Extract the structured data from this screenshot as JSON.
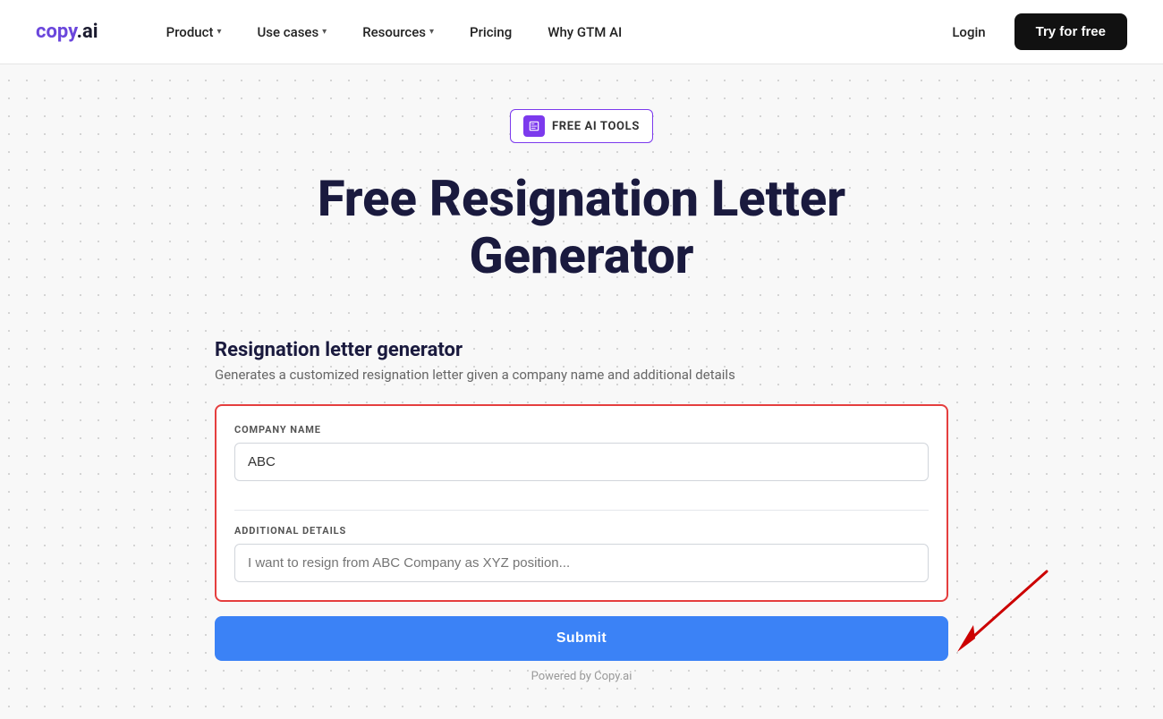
{
  "logo": {
    "text": "copy.ai"
  },
  "nav": {
    "items": [
      {
        "label": "Product",
        "hasDropdown": true
      },
      {
        "label": "Use cases",
        "hasDropdown": true
      },
      {
        "label": "Resources",
        "hasDropdown": true
      },
      {
        "label": "Pricing",
        "hasDropdown": false
      },
      {
        "label": "Why GTM AI",
        "hasDropdown": false
      }
    ],
    "login_label": "Login",
    "try_label": "Try for free"
  },
  "badge": {
    "text": "FREE AI TOOLS"
  },
  "hero": {
    "title": "Free Resignation Letter Generator"
  },
  "form": {
    "section_title": "Resignation letter generator",
    "section_desc": "Generates a customized resignation letter given a company name and additional details",
    "company_name_label": "COMPANY NAME",
    "company_name_value": "ABC",
    "additional_details_label": "ADDITIONAL DETAILS",
    "additional_details_placeholder": "I want to resign from ABC Company as XYZ position...",
    "submit_label": "Submit",
    "powered_by": "Powered by Copy.ai"
  }
}
